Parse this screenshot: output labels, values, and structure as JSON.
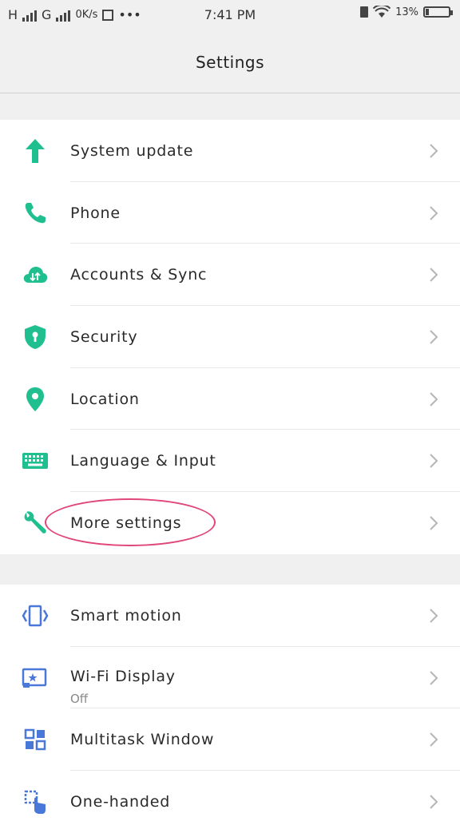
{
  "status_bar": {
    "signal_h": "H",
    "signal_g": "G",
    "speed": "0K/s",
    "dots": "•••",
    "time": "7:41 PM",
    "battery_percent": "13%"
  },
  "header": {
    "title": "Settings"
  },
  "colors": {
    "green": "#1fbf8f",
    "blue": "#4a78d8",
    "annotation": "#e0457b"
  },
  "group1": [
    {
      "label": "System update",
      "icon": "arrow-up-icon"
    },
    {
      "label": "Phone",
      "icon": "phone-icon"
    },
    {
      "label": "Accounts & Sync",
      "icon": "cloud-sync-icon"
    },
    {
      "label": "Security",
      "icon": "shield-icon"
    },
    {
      "label": "Location",
      "icon": "location-pin-icon"
    },
    {
      "label": "Language & Input",
      "icon": "keyboard-icon"
    },
    {
      "label": "More settings",
      "icon": "wrench-icon"
    }
  ],
  "group2": [
    {
      "label": "Smart motion",
      "icon": "smart-motion-icon"
    },
    {
      "label": "Wi-Fi Display",
      "sub": "Off",
      "icon": "wifi-display-icon"
    },
    {
      "label": "Multitask Window",
      "icon": "multitask-window-icon"
    },
    {
      "label": "One-handed",
      "icon": "one-handed-icon"
    }
  ]
}
